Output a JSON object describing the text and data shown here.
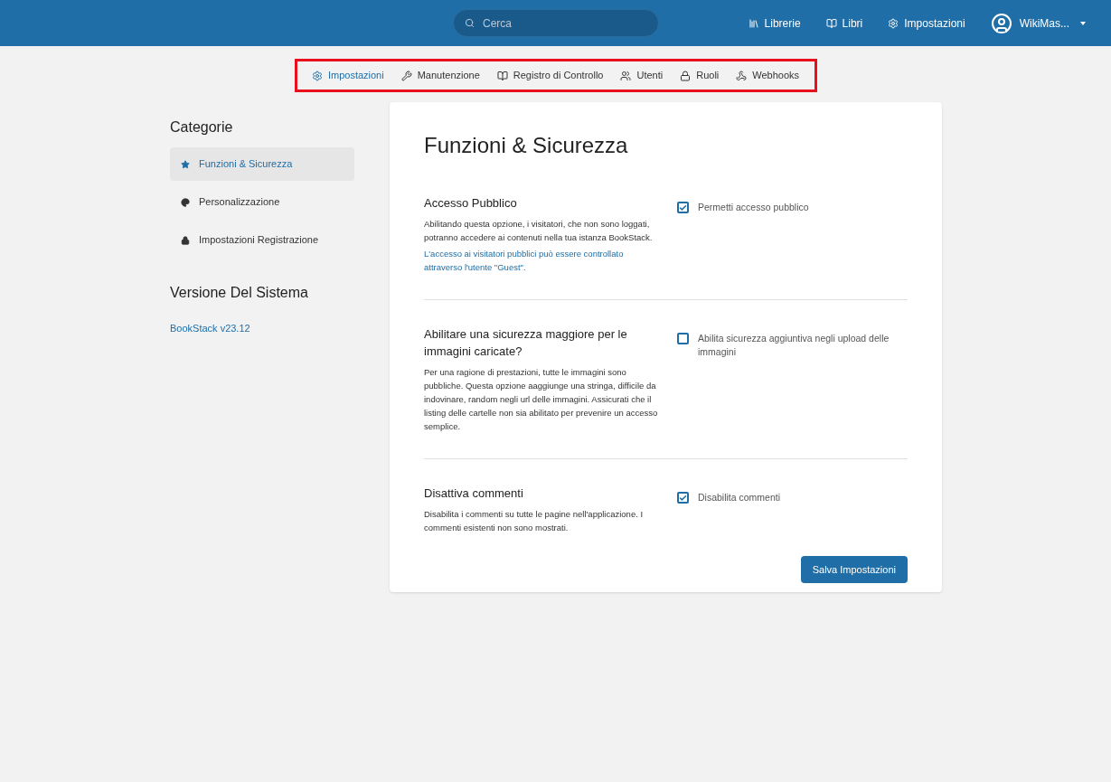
{
  "header": {
    "search": {
      "placeholder": "Cerca"
    },
    "links": [
      {
        "label": "Librerie"
      },
      {
        "label": "Libri"
      },
      {
        "label": "Impostazioni"
      }
    ],
    "user": {
      "name": "WikiMas..."
    }
  },
  "settings_nav": [
    {
      "label": "Impostazioni",
      "selected": true
    },
    {
      "label": "Manutenzione",
      "selected": false
    },
    {
      "label": "Registro di Controllo",
      "selected": false
    },
    {
      "label": "Utenti",
      "selected": false
    },
    {
      "label": "Ruoli",
      "selected": false
    },
    {
      "label": "Webhooks",
      "selected": false
    }
  ],
  "sidebar": {
    "title": "Categorie",
    "items": [
      {
        "label": "Funzioni & Sicurezza",
        "selected": true
      },
      {
        "label": "Personalizzazione",
        "selected": false
      },
      {
        "label": "Impostazioni Registrazione",
        "selected": false
      }
    ],
    "version_title": "Versione Del Sistema",
    "version": "BookStack v23.12"
  },
  "main": {
    "title": "Funzioni & Sicurezza",
    "sections": [
      {
        "title": "Accesso Pubblico",
        "description": "Abilitando questa opzione, i visitatori, che non sono loggati, potranno accedere ai contenuti nella tua istanza BookStack.",
        "note": "L'accesso ai visitatori pubblici può essere controllato attraverso l'utente \"Guest\".",
        "option": "Permetti accesso pubblico",
        "checked": true
      },
      {
        "title": "Abilitare una sicurezza maggiore per le immagini caricate?",
        "description": "Per una ragione di prestazioni, tutte le immagini sono pubbliche. Questa opzione aaggiunge una stringa, difficile da indovinare, random negli url delle immagini. Assicurati che il listing delle cartelle non sia abilitato per prevenire un accesso semplice.",
        "option": "Abilita sicurezza aggiuntiva negli upload delle immagini",
        "checked": false
      },
      {
        "title": "Disattiva commenti",
        "description": "Disabilita i commenti su tutte le pagine nell'applicazione. I commenti esistenti non sono mostrati.",
        "option": "Disabilita commenti",
        "checked": true
      }
    ],
    "save_button": "Salva Impostazioni"
  }
}
